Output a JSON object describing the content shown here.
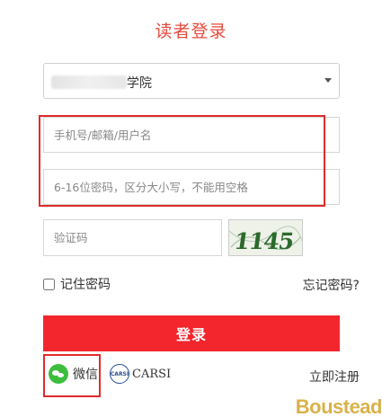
{
  "title": "读者登录",
  "school": {
    "value": "学院"
  },
  "account_input": {
    "placeholder": "手机号/邮箱/用户名"
  },
  "password_input": {
    "placeholder": "6-16位密码，区分大小写，不能用空格"
  },
  "captcha_input": {
    "placeholder": "验证码"
  },
  "captcha_text": "1145",
  "remember_label": "记住密码",
  "forgot_label": "忘记密码?",
  "login_label": "登录",
  "wechat_label": "微信",
  "carsi_label": "CARSI",
  "carsi_icon_text": "CARSI",
  "register_label": "立即注册",
  "brand": "Boustead",
  "colors": {
    "accent": "#f2262c",
    "title": "#e64a3b",
    "highlight": "#e02b2b",
    "wechat": "#3dbd3d",
    "brand": "#d9b24a"
  }
}
